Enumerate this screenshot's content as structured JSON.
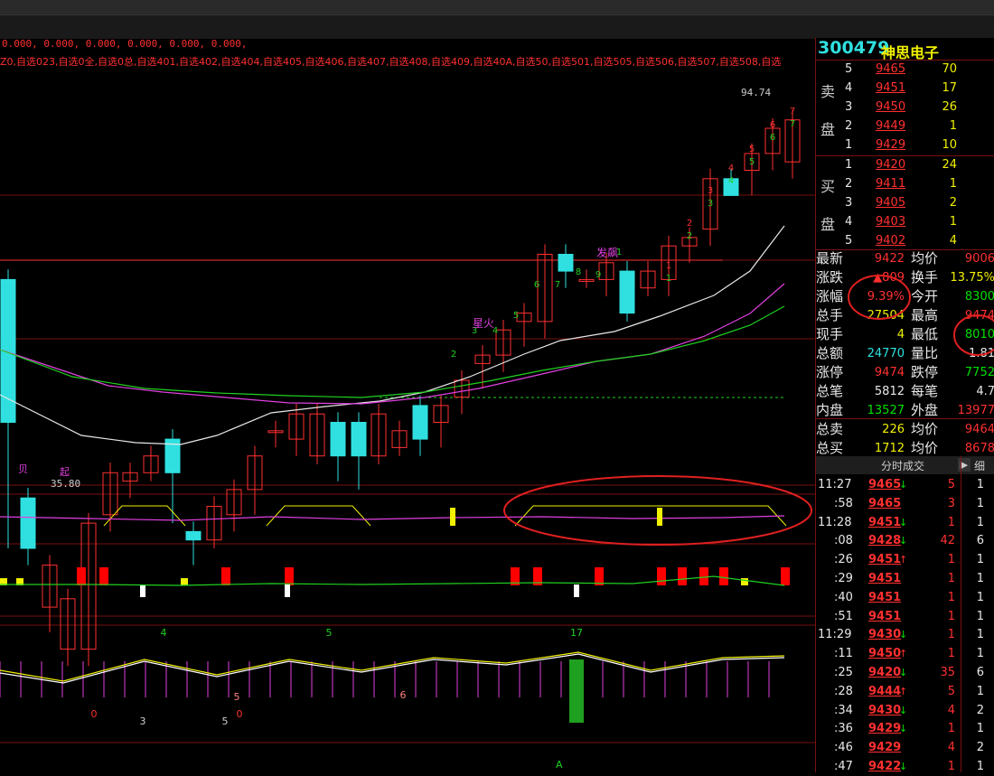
{
  "header": {
    "values_line": "0.000, 0.000, 0.000, 0.000, 0.000, 0.000,",
    "watchlists": "Z0,自选023,自选0全,自选0总,自选401,自选402,自选404,自选405,自选406,自选407,自选408,自选409,自选40A,自选50,自选501,自选505,自选506,自选507,自选508,自选"
  },
  "chart": {
    "high_label": "94.74",
    "low_label": "35.80",
    "annotation_fabiao": "发飙",
    "annotation_xinghuo": "星火",
    "annotation_qi": "起",
    "annotation_bei": "贝",
    "counts_top": [
      "1",
      "2",
      "3",
      "4",
      "5",
      "6",
      "7"
    ],
    "counts_mid": [
      "2",
      "3",
      "4",
      "5",
      "6",
      "7",
      "8",
      "9",
      "1"
    ],
    "ind3_nums": [
      "4",
      "5",
      "17"
    ],
    "ind3_bottom": [
      "0",
      "3",
      "5",
      "0",
      "5",
      "6"
    ],
    "letter_a": "A",
    "colors": {
      "up": "#ff3030",
      "down": "#30e0e0",
      "ma5": "#e8e8e8",
      "ma10": "#e040e0",
      "ma20": "#20d020",
      "grid": "#7a1010"
    }
  },
  "stock": {
    "code": "300479",
    "name": "神思电子",
    "sell_label_1": "卖",
    "sell_label_2": "盘",
    "buy_label_1": "买",
    "buy_label_2": "盘",
    "sells": [
      {
        "level": "5",
        "price": "9465",
        "vol": "70"
      },
      {
        "level": "4",
        "price": "9451",
        "vol": "17"
      },
      {
        "level": "3",
        "price": "9450",
        "vol": "26"
      },
      {
        "level": "2",
        "price": "9449",
        "vol": "1"
      },
      {
        "level": "1",
        "price": "9429",
        "vol": "10"
      }
    ],
    "buys": [
      {
        "level": "1",
        "price": "9420",
        "vol": "24"
      },
      {
        "level": "2",
        "price": "9411",
        "vol": "1"
      },
      {
        "level": "3",
        "price": "9405",
        "vol": "2"
      },
      {
        "level": "4",
        "price": "9403",
        "vol": "1"
      },
      {
        "level": "5",
        "price": "9402",
        "vol": "4"
      }
    ],
    "stats": [
      {
        "k1": "最新",
        "v1": "9422",
        "c1": "red",
        "k2": "均价",
        "v2": "9006",
        "c2": "red"
      },
      {
        "k1": "涨跌",
        "v1": "▲809",
        "c1": "red",
        "k2": "换手",
        "v2": "13.75%",
        "c2": "yellow"
      },
      {
        "k1": "涨幅",
        "v1": "9.39%",
        "c1": "red",
        "k2": "今开",
        "v2": "8300",
        "c2": "green"
      },
      {
        "k1": "总手",
        "v1": "27504",
        "c1": "yellow",
        "k2": "最高",
        "v2": "9474",
        "c2": "red"
      },
      {
        "k1": "现手",
        "v1": "4",
        "c1": "yellow",
        "k2": "最低",
        "v2": "8010",
        "c2": "green"
      },
      {
        "k1": "总额",
        "v1": "24770",
        "c1": "cyan",
        "k2": "量比",
        "v2": "1.81",
        "c2": "white"
      },
      {
        "k1": "涨停",
        "v1": "9474",
        "c1": "red",
        "k2": "跌停",
        "v2": "7752",
        "c2": "green"
      },
      {
        "k1": "总笔",
        "v1": "5812",
        "c1": "white",
        "k2": "每笔",
        "v2": "4.7",
        "c2": "white"
      },
      {
        "k1": "内盘",
        "v1": "13527",
        "c1": "green",
        "k2": "外盘",
        "v2": "13977",
        "c2": "red"
      },
      {
        "k1": "总卖",
        "v1": "226",
        "c1": "yellow",
        "k2": "均价",
        "v2": "9464",
        "c2": "red"
      },
      {
        "k1": "总买",
        "v1": "1712",
        "c1": "yellow",
        "k2": "均价",
        "v2": "8678",
        "c2": "red"
      }
    ],
    "ticks_header": "分时成交",
    "ticks_btn": "▶",
    "ticks_btn2": "细",
    "ticks": [
      {
        "t": "11:27",
        "p": "9465",
        "d": "dn",
        "v": "5",
        "n": "1"
      },
      {
        "t": ":58",
        "p": "9465",
        "d": "",
        "v": "3",
        "n": "1"
      },
      {
        "t": "11:28",
        "p": "9451",
        "d": "dn",
        "v": "1",
        "n": "1"
      },
      {
        "t": ":08",
        "p": "9428",
        "d": "dn",
        "v": "42",
        "n": "6"
      },
      {
        "t": ":26",
        "p": "9451",
        "d": "up",
        "v": "1",
        "n": "1"
      },
      {
        "t": ":29",
        "p": "9451",
        "d": "",
        "v": "1",
        "n": "1"
      },
      {
        "t": ":40",
        "p": "9451",
        "d": "",
        "v": "1",
        "n": "1"
      },
      {
        "t": ":51",
        "p": "9451",
        "d": "",
        "v": "1",
        "n": "1"
      },
      {
        "t": "11:29",
        "p": "9430",
        "d": "dn",
        "v": "1",
        "n": "1"
      },
      {
        "t": ":11",
        "p": "9450",
        "d": "up",
        "v": "1",
        "n": "1"
      },
      {
        "t": ":25",
        "p": "9420",
        "d": "dn",
        "v": "35",
        "n": "6"
      },
      {
        "t": ":28",
        "p": "9444",
        "d": "up",
        "v": "5",
        "n": "1"
      },
      {
        "t": ":34",
        "p": "9430",
        "d": "dn",
        "v": "4",
        "n": "2"
      },
      {
        "t": ":36",
        "p": "9429",
        "d": "dn",
        "v": "1",
        "n": "1"
      },
      {
        "t": ":46",
        "p": "9429",
        "d": "",
        "v": "4",
        "n": "2"
      },
      {
        "t": ":47",
        "p": "9422",
        "d": "dn",
        "v": "1",
        "n": "1"
      }
    ]
  }
}
